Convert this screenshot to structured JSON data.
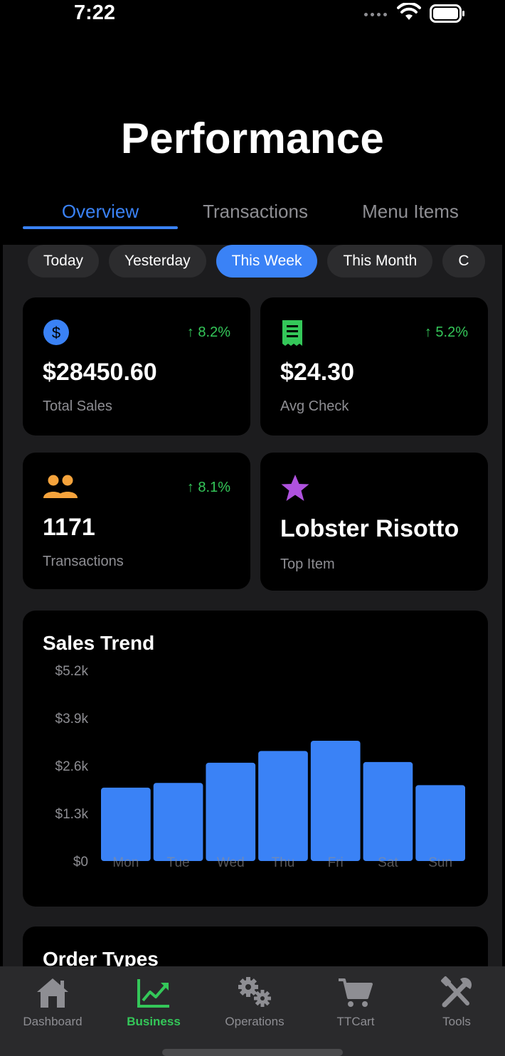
{
  "status": {
    "time": "7:22"
  },
  "title": "Performance",
  "tabs": [
    {
      "label": "Overview",
      "active": true
    },
    {
      "label": "Transactions",
      "active": false
    },
    {
      "label": "Menu Items",
      "active": false
    }
  ],
  "ranges": [
    "Today",
    "Yesterday",
    "This Week",
    "This Month",
    "C"
  ],
  "selected_range": "This Week",
  "stats": [
    {
      "icon": "dollar-circle-icon",
      "delta": "8.2%",
      "value": "$28450.60",
      "label": "Total Sales"
    },
    {
      "icon": "receipt-icon",
      "delta": "5.2%",
      "value": "$24.30",
      "label": "Avg Check"
    },
    {
      "icon": "people-icon",
      "delta": "8.1%",
      "value": "1171",
      "label": "Transactions"
    },
    {
      "icon": "star-icon",
      "delta": "",
      "value": "Lobster Risotto",
      "label": "Top Item"
    }
  ],
  "colors": {
    "accent": "#3a82f6",
    "positive": "#34c759",
    "receipt": "#34c759",
    "people": "#f5a33c",
    "star": "#af52de",
    "card": "#000000",
    "surface": "#1c1c1e"
  },
  "order_types": {
    "title": "Order Types"
  },
  "chart_data": {
    "type": "bar",
    "title": "Sales Trend",
    "categories": [
      "Mon",
      "Tue",
      "Wed",
      "Thu",
      "Fri",
      "Sat",
      "Sun"
    ],
    "values": [
      2000,
      2130,
      2680,
      3000,
      3280,
      2700,
      2070
    ],
    "y_ticks": [
      "$0",
      "$1.3k",
      "$2.6k",
      "$3.9k",
      "$5.2k"
    ],
    "ylim": [
      0,
      5200
    ],
    "grid": false
  },
  "tabbar": [
    {
      "label": "Dashboard",
      "icon": "house-icon",
      "active": false
    },
    {
      "label": "Business",
      "icon": "chart-line-icon",
      "active": true
    },
    {
      "label": "Operations",
      "icon": "gears-icon",
      "active": false
    },
    {
      "label": "TTCart",
      "icon": "cart-icon",
      "active": false
    },
    {
      "label": "Tools",
      "icon": "tools-icon",
      "active": false
    }
  ]
}
